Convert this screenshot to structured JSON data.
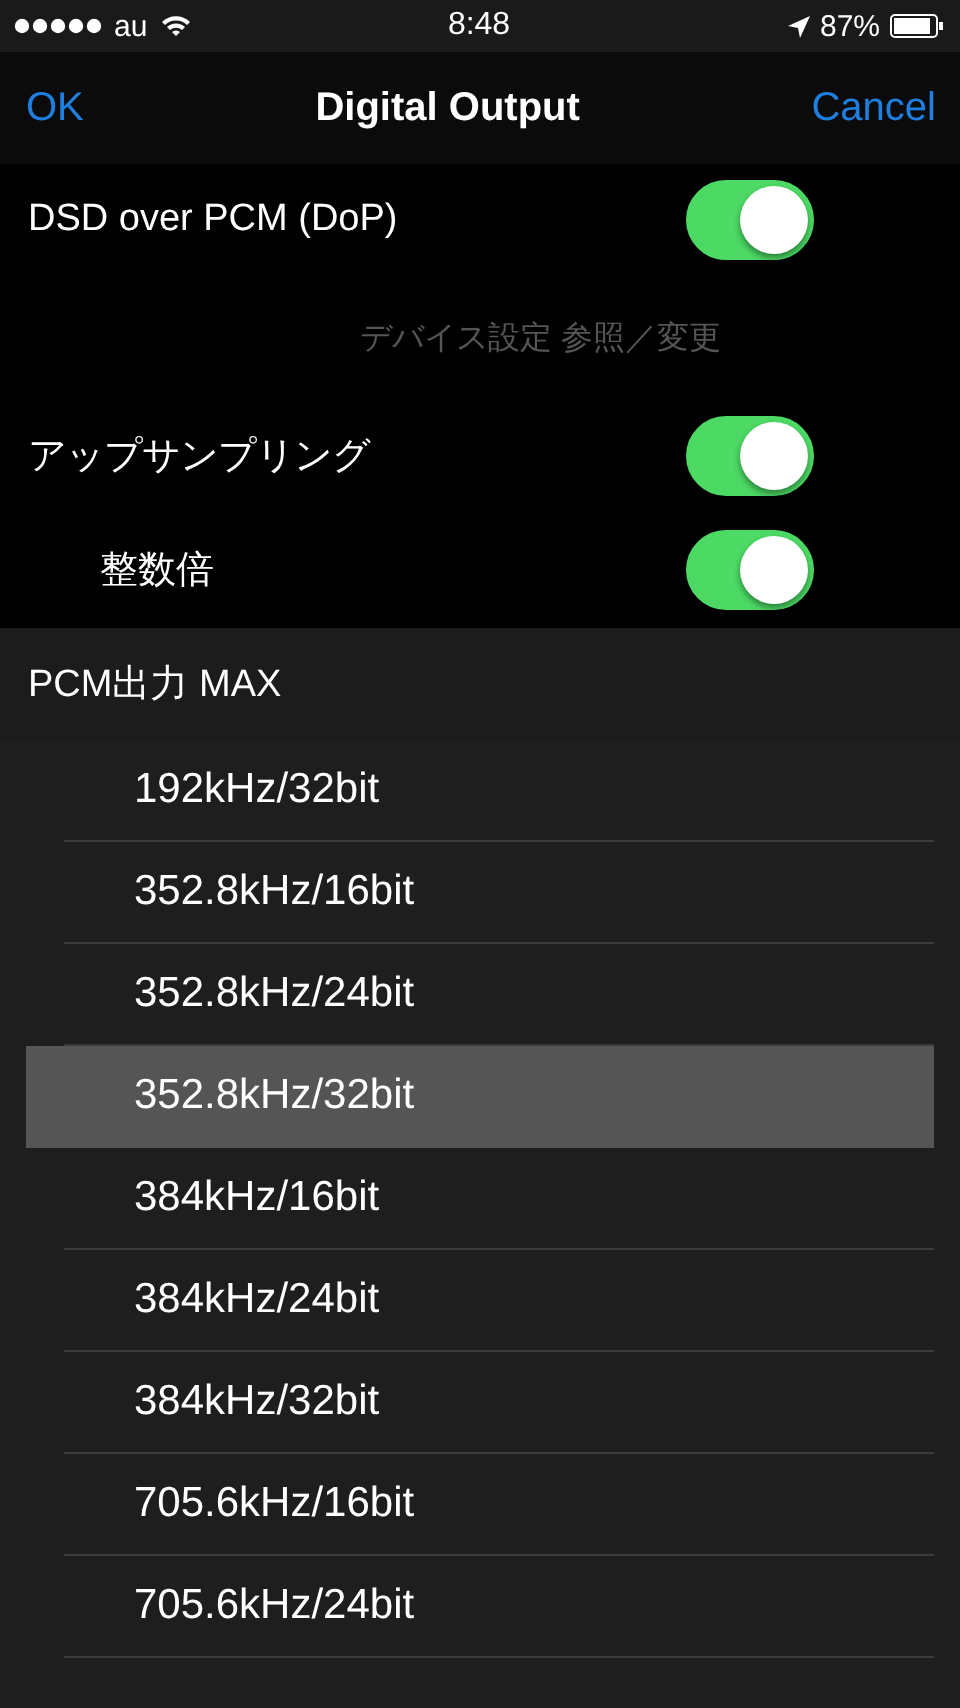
{
  "status_bar": {
    "carrier": "au",
    "time": "8:48",
    "battery": "87%"
  },
  "nav": {
    "left": "OK",
    "title": "Digital Output",
    "right": "Cancel"
  },
  "settings": [
    {
      "kind": "switch",
      "label": "DSD over PCM (DoP)",
      "on": true,
      "indented": false
    },
    {
      "kind": "caption",
      "text": "デバイス設定 参照／変更"
    },
    {
      "kind": "switch",
      "label": "アップサンプリング",
      "on": true,
      "indented": false
    },
    {
      "kind": "switch",
      "label": "整数倍",
      "on": true,
      "indented": true
    }
  ],
  "section": {
    "header": "PCM出力 MAX"
  },
  "options": [
    {
      "label": "192kHz/32bit",
      "selected": false
    },
    {
      "label": "352.8kHz/16bit",
      "selected": false
    },
    {
      "label": "352.8kHz/24bit",
      "selected": false
    },
    {
      "label": "352.8kHz/32bit",
      "selected": true
    },
    {
      "label": "384kHz/16bit",
      "selected": false
    },
    {
      "label": "384kHz/24bit",
      "selected": false
    },
    {
      "label": "384kHz/32bit",
      "selected": false
    },
    {
      "label": "705.6kHz/16bit",
      "selected": false
    },
    {
      "label": "705.6kHz/24bit",
      "selected": false
    }
  ]
}
